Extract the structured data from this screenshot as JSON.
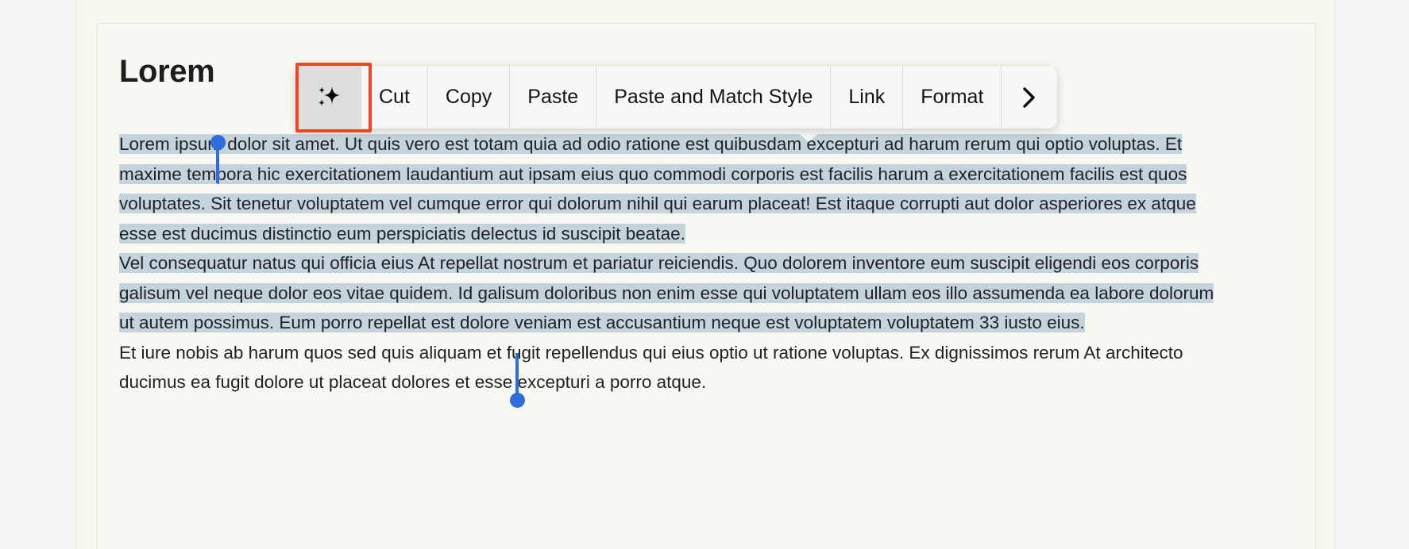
{
  "document": {
    "title": "Lorem",
    "paragraphs": [
      {
        "selected": true,
        "text": "Lorem ipsum dolor sit amet. Ut quis vero est totam quia ad odio ratione est quibusdam excepturi ad harum rerum qui optio voluptas. Et maxime tempora hic exercitationem laudantium aut ipsam eius quo commodi corporis est facilis harum a exercitationem facilis est quos voluptates. Sit tenetur voluptatem vel cumque error qui dolorum nihil qui earum placeat! Est itaque corrupti aut dolor asperiores ex atque esse est ducimus distinctio eum perspiciatis delectus id suscipit beatae."
      },
      {
        "selected": true,
        "text": "Vel consequatur natus qui officia eius At repellat nostrum et pariatur reiciendis. Quo dolorem inventore eum suscipit eligendi eos corporis galisum vel neque dolor eos vitae quidem. Id galisum doloribus non enim esse qui voluptatem ullam eos illo assumenda ea labore dolorum ut autem possimus. Eum porro repellat est dolore veniam est accusantium neque est voluptatem voluptatem 33 iusto eius."
      },
      {
        "selected": false,
        "text": "Et iure nobis ab harum quos sed quis aliquam et fugit repellendus qui eius optio ut ratione voluptas. Ex dignissimos rerum At architecto ducimus ea fugit dolore ut placeat dolores et esse excepturi a porro atque."
      }
    ]
  },
  "context_menu": {
    "items": [
      {
        "id": "ai-writing-tools",
        "label": "",
        "icon": "sparkle-icon",
        "active": true
      },
      {
        "id": "cut",
        "label": "Cut",
        "icon": "",
        "active": false
      },
      {
        "id": "copy",
        "label": "Copy",
        "icon": "",
        "active": false
      },
      {
        "id": "paste",
        "label": "Paste",
        "icon": "",
        "active": false
      },
      {
        "id": "paste-and-match-style",
        "label": "Paste and Match Style",
        "icon": "",
        "active": false
      },
      {
        "id": "link",
        "label": "Link",
        "icon": "",
        "active": false
      },
      {
        "id": "format",
        "label": "Format",
        "icon": "",
        "active": false
      },
      {
        "id": "more",
        "label": "",
        "icon": "chevron-right-icon",
        "active": false
      }
    ]
  },
  "selection": {
    "highlight_color": "#c5d3dc",
    "handle_color": "#2f6ddd"
  },
  "highlight": {
    "focus_ring_color": "#ee4525",
    "target": "ai-writing-tools"
  },
  "theme": {
    "page_background": "#f7f7ee",
    "card_background": "#f8f8f2",
    "text_color": "#1f2124",
    "menu_background": "#f7f7f7",
    "menu_active_background": "#dedede"
  }
}
